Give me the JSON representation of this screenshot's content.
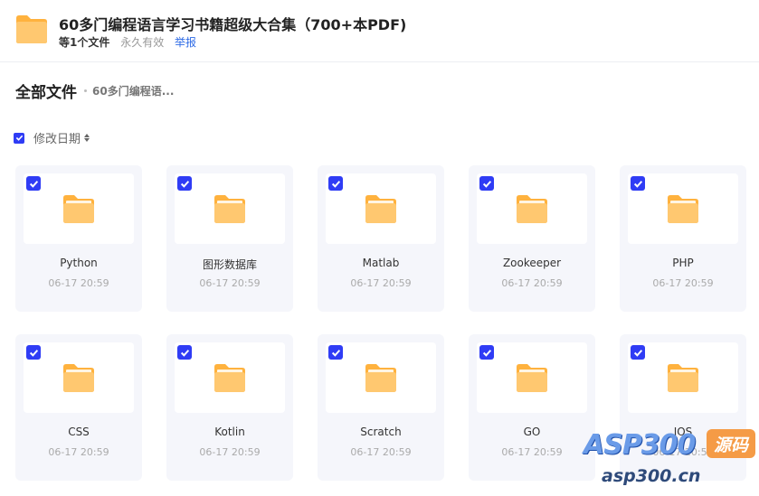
{
  "share": {
    "title": "60多门编程语言学习书籍超级大合集（700+本PDF)",
    "file_count": "等1个文件",
    "validity": "永久有效",
    "report_label": "举报"
  },
  "breadcrumb": {
    "root": "全部文件",
    "current": "60多门编程语..."
  },
  "sort": {
    "label": "修改日期"
  },
  "files": [
    {
      "name": "Python",
      "date": "06-17 20:59"
    },
    {
      "name": "图形数据库",
      "date": "06-17 20:59"
    },
    {
      "name": "Matlab",
      "date": "06-17 20:59"
    },
    {
      "name": "Zookeeper",
      "date": "06-17 20:59"
    },
    {
      "name": "PHP",
      "date": "06-17 20:59"
    },
    {
      "name": "CSS",
      "date": "06-17 20:59"
    },
    {
      "name": "Kotlin",
      "date": "06-17 20:59"
    },
    {
      "name": "Scratch",
      "date": "06-17 20:59"
    },
    {
      "name": "GO",
      "date": "06-17 20:59"
    },
    {
      "name": "IOS",
      "date": "06-17 20:59"
    }
  ],
  "watermark": {
    "main": "ASP300",
    "badge": "源码",
    "sub": "asp300.cn"
  },
  "colors": {
    "accent": "#2f3cf5",
    "folder": "#ffc870",
    "link": "#2e6be6"
  },
  "icons": {
    "folder": "folder-icon",
    "checkbox": "checkbox-checked-icon",
    "sort": "sort-icon"
  }
}
